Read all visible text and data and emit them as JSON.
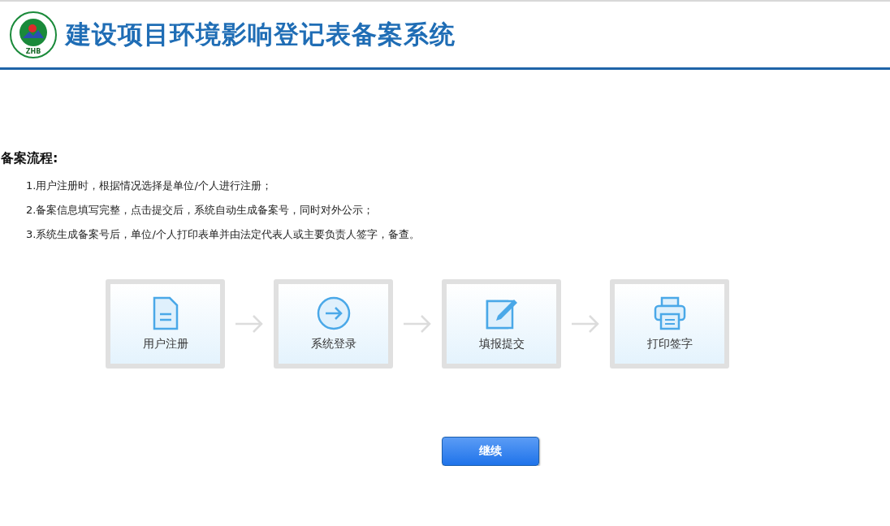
{
  "header": {
    "logo_text": "ZHB",
    "title": "建设项目环境影响登记表备案系统"
  },
  "process": {
    "heading": "备案流程:",
    "items": [
      "1.用户注册时，根据情况选择是单位/个人进行注册；",
      "2.备案信息填写完整，点击提交后，系统自动生成备案号，同时对外公示；",
      "3.系统生成备案号后，单位/个人打印表单并由法定代表人或主要负责人签字，备查。"
    ]
  },
  "steps": [
    {
      "kind": "document",
      "label": "用户注册"
    },
    {
      "kind": "login",
      "label": "系统登录"
    },
    {
      "kind": "edit",
      "label": "填报提交"
    },
    {
      "kind": "print",
      "label": "打印签字"
    }
  ],
  "continue_button": "继续"
}
